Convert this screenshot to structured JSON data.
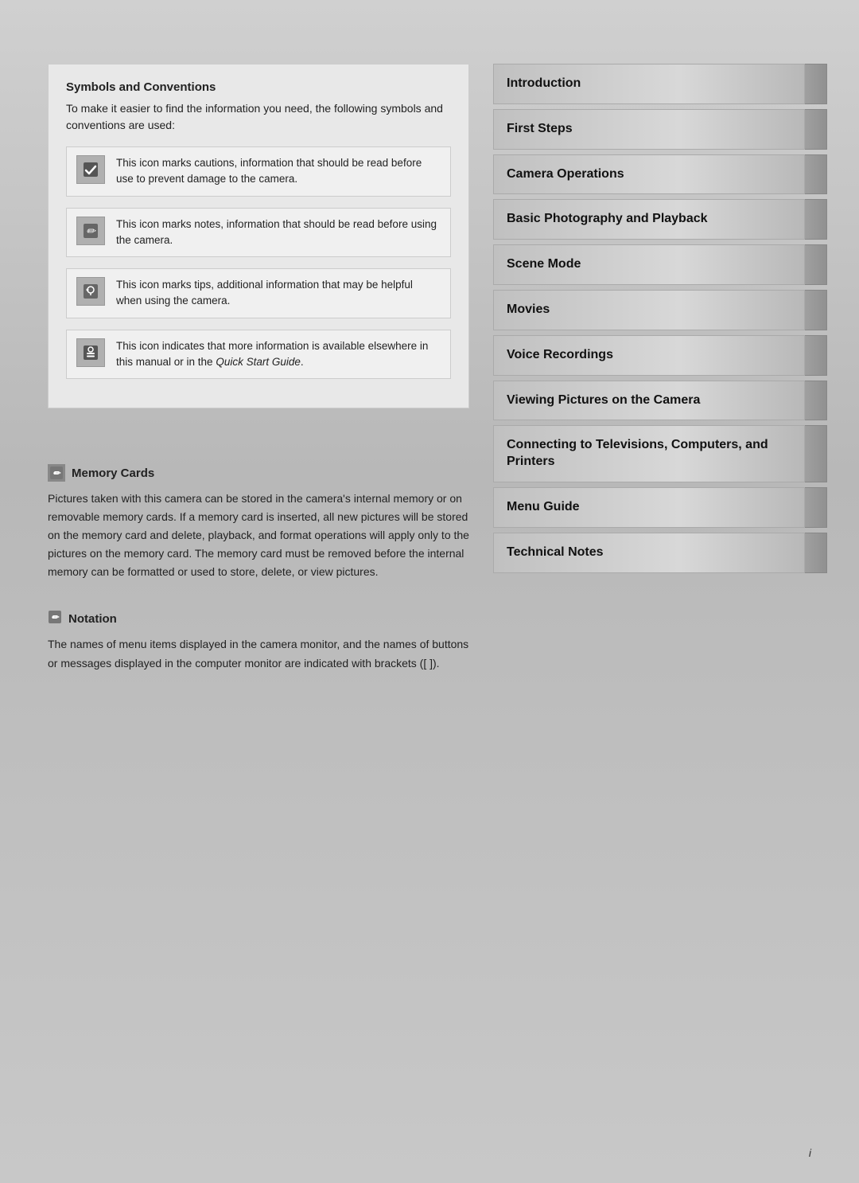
{
  "left": {
    "symbols_title": "Symbols and Conventions",
    "symbols_desc": "To make it easier to find the information you need, the following symbols and conventions are used:",
    "icons": [
      {
        "symbol": "✓",
        "text": "This icon marks cautions, information that should be read before use to prevent damage to the camera."
      },
      {
        "symbol": "✏",
        "text": "This icon marks notes, information that should be read before using the camera."
      },
      {
        "symbol": "🔍",
        "text": "This icon marks tips, additional information that may be helpful when using the camera."
      },
      {
        "symbol": "⚙",
        "text": "This icon indicates that more information is available elsewhere in this manual or in the Quick Start Guide."
      }
    ],
    "memory_heading": "Memory Cards",
    "memory_body": "Pictures taken with this camera can be stored in the camera's internal memory or on removable memory cards.  If a memory card is inserted, all new pictures will be stored on the memory card and delete, playback, and format operations will apply only to the pictures on the memory card.  The memory card must be removed before the internal memory can be formatted or used to store, delete, or view pictures.",
    "notation_heading": "Notation",
    "notation_body": "The names of menu items displayed in the camera monitor, and the names of buttons or messages displayed in the computer monitor are indicated with brackets ([ ]).",
    "italic_text": "Quick Start Guide",
    "page_num": "i"
  },
  "toc": {
    "items": [
      {
        "label": "Introduction"
      },
      {
        "label": "First Steps"
      },
      {
        "label": "Camera Operations"
      },
      {
        "label": "Basic Photography and Playback"
      },
      {
        "label": "Scene Mode"
      },
      {
        "label": "Movies"
      },
      {
        "label": "Voice Recordings"
      },
      {
        "label": "Viewing Pictures on the Camera"
      },
      {
        "label": "Connecting to Televisions, Computers, and Printers"
      },
      {
        "label": "Menu Guide"
      },
      {
        "label": "Technical Notes"
      }
    ]
  }
}
